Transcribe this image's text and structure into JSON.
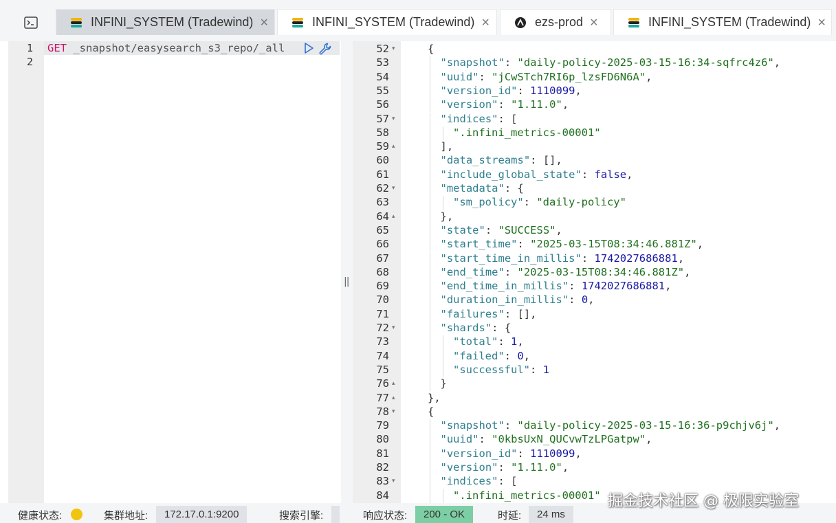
{
  "tabs": [
    {
      "label": "INFINI_SYSTEM (Tradewind)",
      "logo": "easysearch-logo",
      "active": true
    },
    {
      "label": "INFINI_SYSTEM (Tradewind)",
      "logo": "easysearch-logo",
      "active": false
    },
    {
      "label": "ezs-prod",
      "logo": "opensearch-logo",
      "active": false
    },
    {
      "label": "INFINI_SYSTEM (Tradewind)",
      "logo": "easysearch-logo",
      "active": false
    }
  ],
  "tab_close_glyph": "×",
  "request": {
    "line_numbers": [
      "1",
      "2"
    ],
    "method": "GET",
    "path": " _snapshot/easysearch_s3_repo/_all"
  },
  "divider_grip": "||",
  "response": {
    "lines": [
      {
        "n": "52",
        "fold": "▾",
        "indent": 0,
        "parts": [
          [
            "p",
            "{"
          ]
        ]
      },
      {
        "n": "53",
        "fold": "",
        "indent": 1,
        "parts": [
          [
            "k",
            "\"snapshot\""
          ],
          [
            "p",
            ": "
          ],
          [
            "s",
            "\"daily-policy-2025-03-15-16:34-sqfrc4z6\""
          ],
          [
            "p",
            ","
          ]
        ]
      },
      {
        "n": "54",
        "fold": "",
        "indent": 1,
        "parts": [
          [
            "k",
            "\"uuid\""
          ],
          [
            "p",
            ": "
          ],
          [
            "s",
            "\"jCwSTch7RI6p_lzsFD6N6A\""
          ],
          [
            "p",
            ","
          ]
        ]
      },
      {
        "n": "55",
        "fold": "",
        "indent": 1,
        "parts": [
          [
            "k",
            "\"version_id\""
          ],
          [
            "p",
            ": "
          ],
          [
            "n",
            "1110099"
          ],
          [
            "p",
            ","
          ]
        ]
      },
      {
        "n": "56",
        "fold": "",
        "indent": 1,
        "parts": [
          [
            "k",
            "\"version\""
          ],
          [
            "p",
            ": "
          ],
          [
            "s",
            "\"1.11.0\""
          ],
          [
            "p",
            ","
          ]
        ]
      },
      {
        "n": "57",
        "fold": "▾",
        "indent": 1,
        "parts": [
          [
            "k",
            "\"indices\""
          ],
          [
            "p",
            ": ["
          ]
        ]
      },
      {
        "n": "58",
        "fold": "",
        "indent": 2,
        "parts": [
          [
            "s",
            "\".infini_metrics-00001\""
          ]
        ]
      },
      {
        "n": "59",
        "fold": "▴",
        "indent": 1,
        "parts": [
          [
            "p",
            "],"
          ]
        ]
      },
      {
        "n": "60",
        "fold": "",
        "indent": 1,
        "parts": [
          [
            "k",
            "\"data_streams\""
          ],
          [
            "p",
            ": [],"
          ]
        ]
      },
      {
        "n": "61",
        "fold": "",
        "indent": 1,
        "parts": [
          [
            "k",
            "\"include_global_state\""
          ],
          [
            "p",
            ": "
          ],
          [
            "b",
            "false"
          ],
          [
            "p",
            ","
          ]
        ]
      },
      {
        "n": "62",
        "fold": "▾",
        "indent": 1,
        "parts": [
          [
            "k",
            "\"metadata\""
          ],
          [
            "p",
            ": {"
          ]
        ]
      },
      {
        "n": "63",
        "fold": "",
        "indent": 2,
        "parts": [
          [
            "k",
            "\"sm_policy\""
          ],
          [
            "p",
            ": "
          ],
          [
            "s",
            "\"daily-policy\""
          ]
        ]
      },
      {
        "n": "64",
        "fold": "▴",
        "indent": 1,
        "parts": [
          [
            "p",
            "},"
          ]
        ]
      },
      {
        "n": "65",
        "fold": "",
        "indent": 1,
        "parts": [
          [
            "k",
            "\"state\""
          ],
          [
            "p",
            ": "
          ],
          [
            "s",
            "\"SUCCESS\""
          ],
          [
            "p",
            ","
          ]
        ]
      },
      {
        "n": "66",
        "fold": "",
        "indent": 1,
        "parts": [
          [
            "k",
            "\"start_time\""
          ],
          [
            "p",
            ": "
          ],
          [
            "s",
            "\"2025-03-15T08:34:46.881Z\""
          ],
          [
            "p",
            ","
          ]
        ]
      },
      {
        "n": "67",
        "fold": "",
        "indent": 1,
        "parts": [
          [
            "k",
            "\"start_time_in_millis\""
          ],
          [
            "p",
            ": "
          ],
          [
            "n",
            "1742027686881"
          ],
          [
            "p",
            ","
          ]
        ]
      },
      {
        "n": "68",
        "fold": "",
        "indent": 1,
        "parts": [
          [
            "k",
            "\"end_time\""
          ],
          [
            "p",
            ": "
          ],
          [
            "s",
            "\"2025-03-15T08:34:46.881Z\""
          ],
          [
            "p",
            ","
          ]
        ]
      },
      {
        "n": "69",
        "fold": "",
        "indent": 1,
        "parts": [
          [
            "k",
            "\"end_time_in_millis\""
          ],
          [
            "p",
            ": "
          ],
          [
            "n",
            "1742027686881"
          ],
          [
            "p",
            ","
          ]
        ]
      },
      {
        "n": "70",
        "fold": "",
        "indent": 1,
        "parts": [
          [
            "k",
            "\"duration_in_millis\""
          ],
          [
            "p",
            ": "
          ],
          [
            "n",
            "0"
          ],
          [
            "p",
            ","
          ]
        ]
      },
      {
        "n": "71",
        "fold": "",
        "indent": 1,
        "parts": [
          [
            "k",
            "\"failures\""
          ],
          [
            "p",
            ": [],"
          ]
        ]
      },
      {
        "n": "72",
        "fold": "▾",
        "indent": 1,
        "parts": [
          [
            "k",
            "\"shards\""
          ],
          [
            "p",
            ": {"
          ]
        ]
      },
      {
        "n": "73",
        "fold": "",
        "indent": 2,
        "parts": [
          [
            "k",
            "\"total\""
          ],
          [
            "p",
            ": "
          ],
          [
            "n",
            "1"
          ],
          [
            "p",
            ","
          ]
        ]
      },
      {
        "n": "74",
        "fold": "",
        "indent": 2,
        "parts": [
          [
            "k",
            "\"failed\""
          ],
          [
            "p",
            ": "
          ],
          [
            "n",
            "0"
          ],
          [
            "p",
            ","
          ]
        ]
      },
      {
        "n": "75",
        "fold": "",
        "indent": 2,
        "parts": [
          [
            "k",
            "\"successful\""
          ],
          [
            "p",
            ": "
          ],
          [
            "n",
            "1"
          ]
        ]
      },
      {
        "n": "76",
        "fold": "▴",
        "indent": 1,
        "parts": [
          [
            "p",
            "}"
          ]
        ]
      },
      {
        "n": "77",
        "fold": "▴",
        "indent": 0,
        "parts": [
          [
            "p",
            "},"
          ]
        ]
      },
      {
        "n": "78",
        "fold": "▾",
        "indent": 0,
        "parts": [
          [
            "p",
            "{"
          ]
        ]
      },
      {
        "n": "79",
        "fold": "",
        "indent": 1,
        "parts": [
          [
            "k",
            "\"snapshot\""
          ],
          [
            "p",
            ": "
          ],
          [
            "s",
            "\"daily-policy-2025-03-15-16:36-p9chjv6j\""
          ],
          [
            "p",
            ","
          ]
        ]
      },
      {
        "n": "80",
        "fold": "",
        "indent": 1,
        "parts": [
          [
            "k",
            "\"uuid\""
          ],
          [
            "p",
            ": "
          ],
          [
            "s",
            "\"0kbsUxN_QUCvwTzLPGatpw\""
          ],
          [
            "p",
            ","
          ]
        ]
      },
      {
        "n": "81",
        "fold": "",
        "indent": 1,
        "parts": [
          [
            "k",
            "\"version_id\""
          ],
          [
            "p",
            ": "
          ],
          [
            "n",
            "1110099"
          ],
          [
            "p",
            ","
          ]
        ]
      },
      {
        "n": "82",
        "fold": "",
        "indent": 1,
        "parts": [
          [
            "k",
            "\"version\""
          ],
          [
            "p",
            ": "
          ],
          [
            "s",
            "\"1.11.0\""
          ],
          [
            "p",
            ","
          ]
        ]
      },
      {
        "n": "83",
        "fold": "▾",
        "indent": 1,
        "parts": [
          [
            "k",
            "\"indices\""
          ],
          [
            "p",
            ": ["
          ]
        ]
      },
      {
        "n": "84",
        "fold": "",
        "indent": 2,
        "parts": [
          [
            "s",
            "\".infini_metrics-00001\""
          ]
        ]
      }
    ]
  },
  "status": {
    "health_label": "健康状态:",
    "health_color": "#f1c40f",
    "cluster_label": "集群地址:",
    "cluster_value": "172.17.0.1:9200",
    "engine_label": "搜索引擎:",
    "response_label": "响应状态:",
    "response_value": "200 - OK",
    "latency_label": "时延:",
    "latency_value": "24 ms"
  },
  "watermark": "掘金技术社区 @ 极限实验室",
  "colors": {
    "accent_ok": "#7ccfa4",
    "key": "#2f7f8f",
    "string": "#207020",
    "number": "#1a1aa6",
    "method": "#c5186a"
  }
}
